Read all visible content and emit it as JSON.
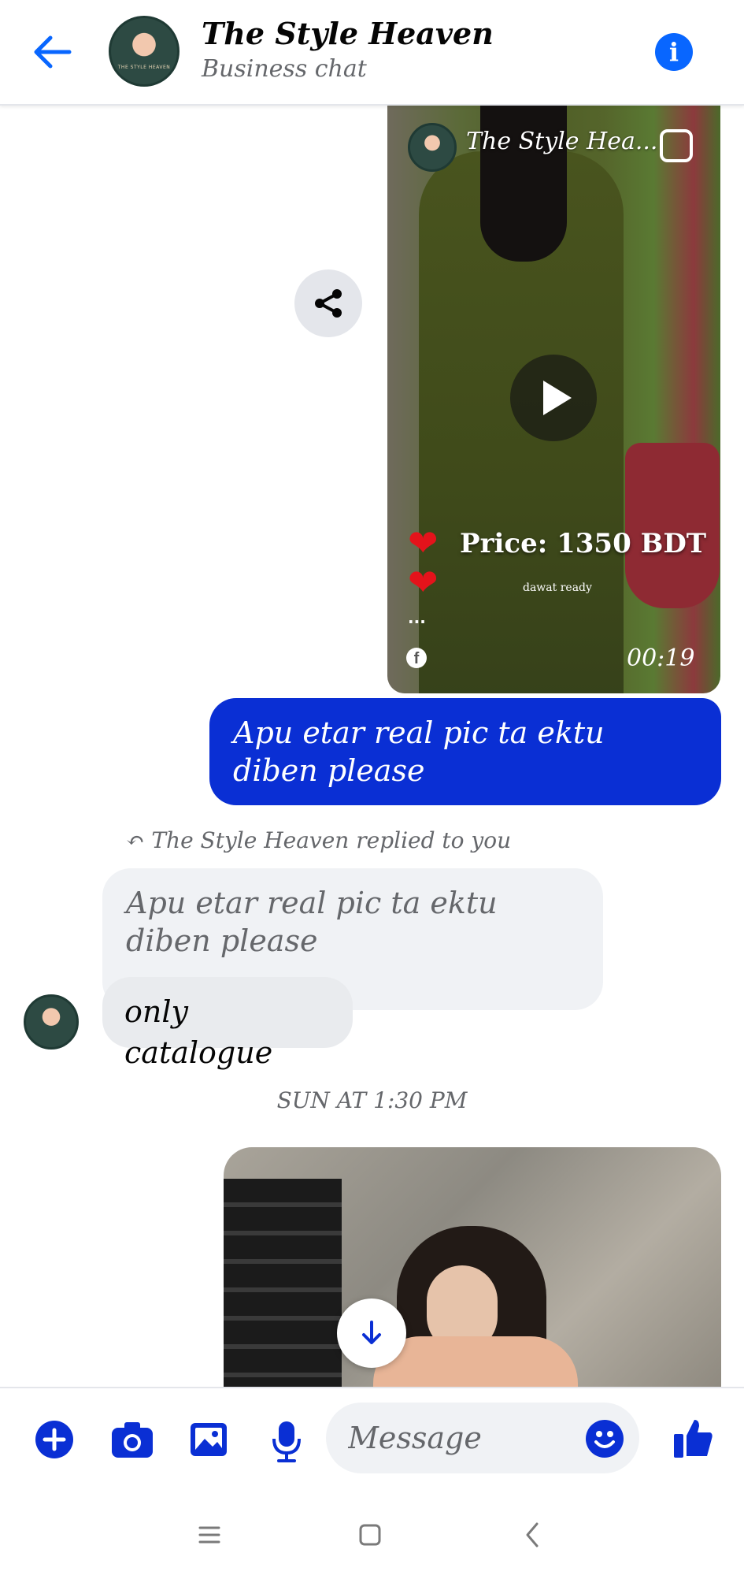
{
  "header": {
    "title": "The Style Heaven",
    "subtitle": "Business chat",
    "back_icon": "arrow-left-icon",
    "info_icon": "info-icon",
    "avatar_text": "THE STYLE HEAVEN"
  },
  "video_post": {
    "page_name": "The Style Hea...",
    "price_text": "Price: 1350 BDT",
    "duration": "00:19",
    "caption_small": "dawat ready",
    "more_dots": "...",
    "facebook_glyph": "f",
    "heart_glyph": "❤"
  },
  "messages": {
    "outgoing_text": "Apu etar real pic ta ektu diben please",
    "reply_note": "The Style Heaven replied to you",
    "quoted_text": "Apu etar real pic ta ektu diben please",
    "incoming_text": "only catalogue",
    "timestamp": "SUN AT 1:30 PM"
  },
  "composer": {
    "placeholder": "Message"
  },
  "colors": {
    "brand_blue": "#0a2fd4",
    "accent_blue": "#0866ff",
    "muted_text": "#65676b",
    "bubble_gray": "#f0f2f5"
  },
  "icons": [
    "arrow-left-icon",
    "info-icon",
    "share-icon",
    "play-icon",
    "reel-icon",
    "facebook-icon",
    "scroll-down-icon",
    "plus-icon",
    "camera-icon",
    "gallery-icon",
    "mic-icon",
    "emoji-icon",
    "thumbs-up-icon",
    "menu-icon",
    "home-icon",
    "back-nav-icon"
  ]
}
